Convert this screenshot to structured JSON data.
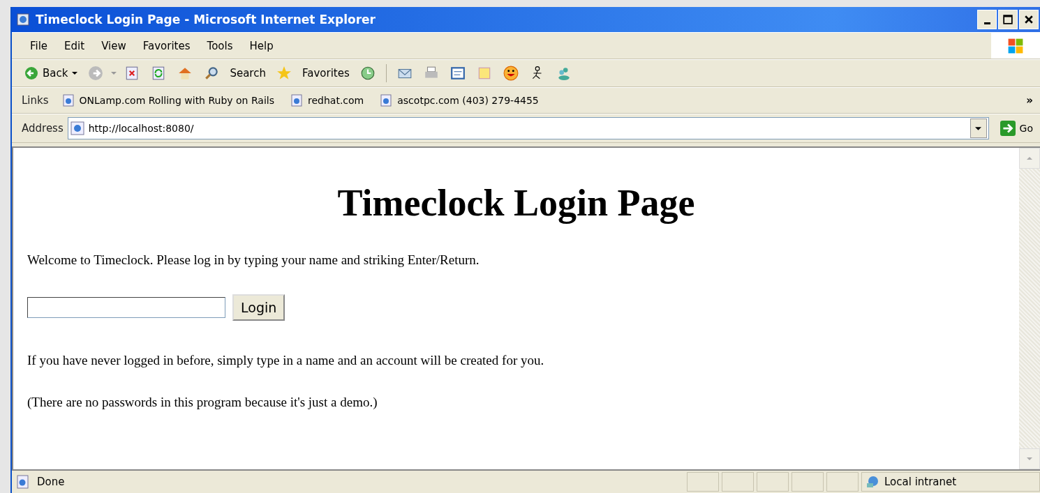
{
  "window": {
    "title": "Timeclock Login Page - Microsoft Internet Explorer"
  },
  "menu": [
    "File",
    "Edit",
    "View",
    "Favorites",
    "Tools",
    "Help"
  ],
  "toolbar": {
    "back": "Back",
    "search": "Search",
    "favorites": "Favorites"
  },
  "links": {
    "label": "Links",
    "items": [
      "ONLamp.com Rolling with Ruby on Rails",
      "redhat.com",
      "ascotpc.com (403) 279-4455"
    ],
    "overflow": "»"
  },
  "address": {
    "label": "Address",
    "url": "http://localhost:8080/",
    "go": "Go"
  },
  "page": {
    "heading": "Timeclock Login Page",
    "welcome": "Welcome to Timeclock. Please log in by typing your name and striking Enter/Return.",
    "login_button": "Login",
    "notes": [
      "If you have never logged in before, simply type in a name and an account will be created for you.",
      "(There are no passwords in this program because it's just a demo.)"
    ]
  },
  "status_bar": {
    "text": "Done",
    "zone": "Local intranet"
  }
}
